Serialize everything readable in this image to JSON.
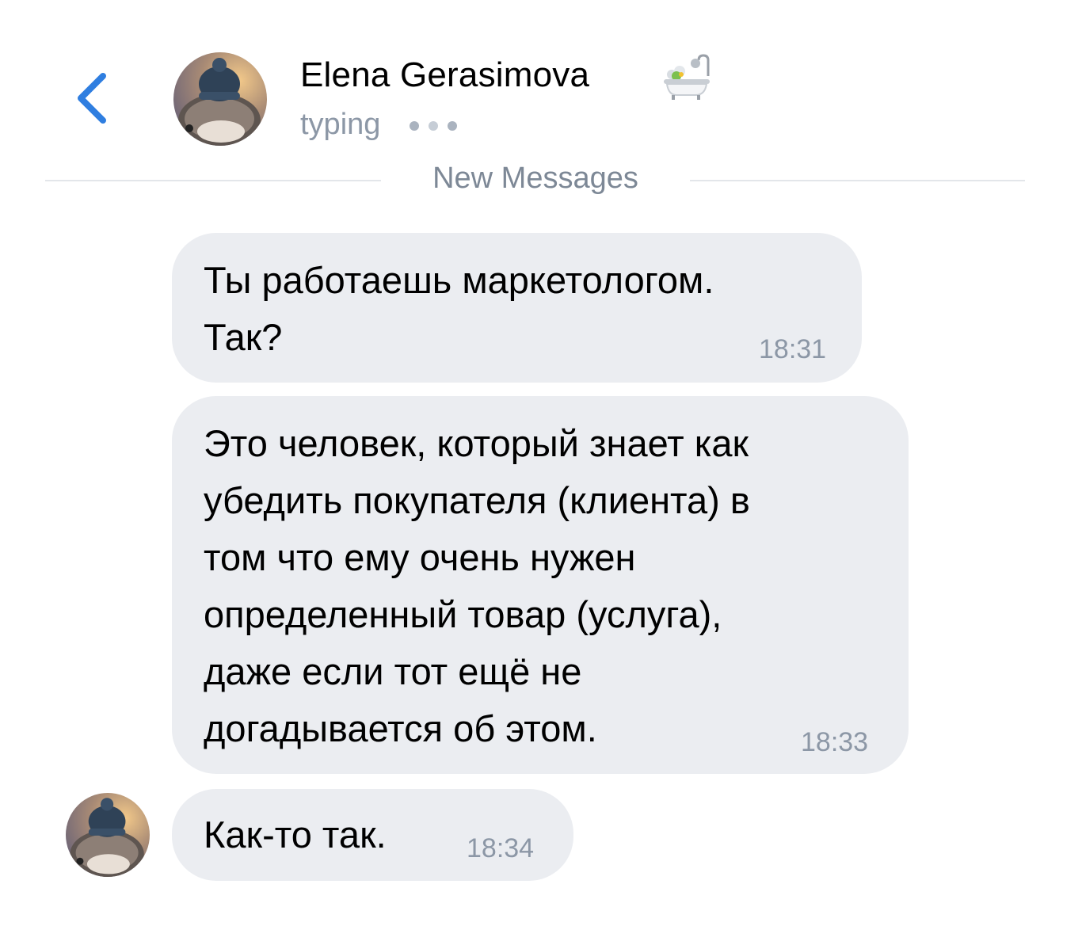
{
  "header": {
    "back_icon": "chevron-left-icon",
    "contact_name": "Elena Gerasimova",
    "name_emoji_icon": "bathtub-icon",
    "status": "typing",
    "status_indicator_icon": "typing-dots-icon",
    "accent_color": "#2f7ee0"
  },
  "divider": {
    "label": "New Messages"
  },
  "messages": [
    {
      "text": "Ты работаешь маркетологом.\nТак?",
      "time": "18:31"
    },
    {
      "text": "Это человек, который знает как\nубедить покупателя (клиента) в\nтом что ему очень нужен\nопределенный товар (услуга),\nдаже если тот ещё не\nдогадывается об этом.",
      "time": "18:33"
    },
    {
      "text": "Как-то так.",
      "time": "18:34"
    }
  ],
  "colors": {
    "bubble_background": "#ebedf1",
    "secondary_text": "#8c97a6",
    "divider_line": "#e3e6ea"
  }
}
